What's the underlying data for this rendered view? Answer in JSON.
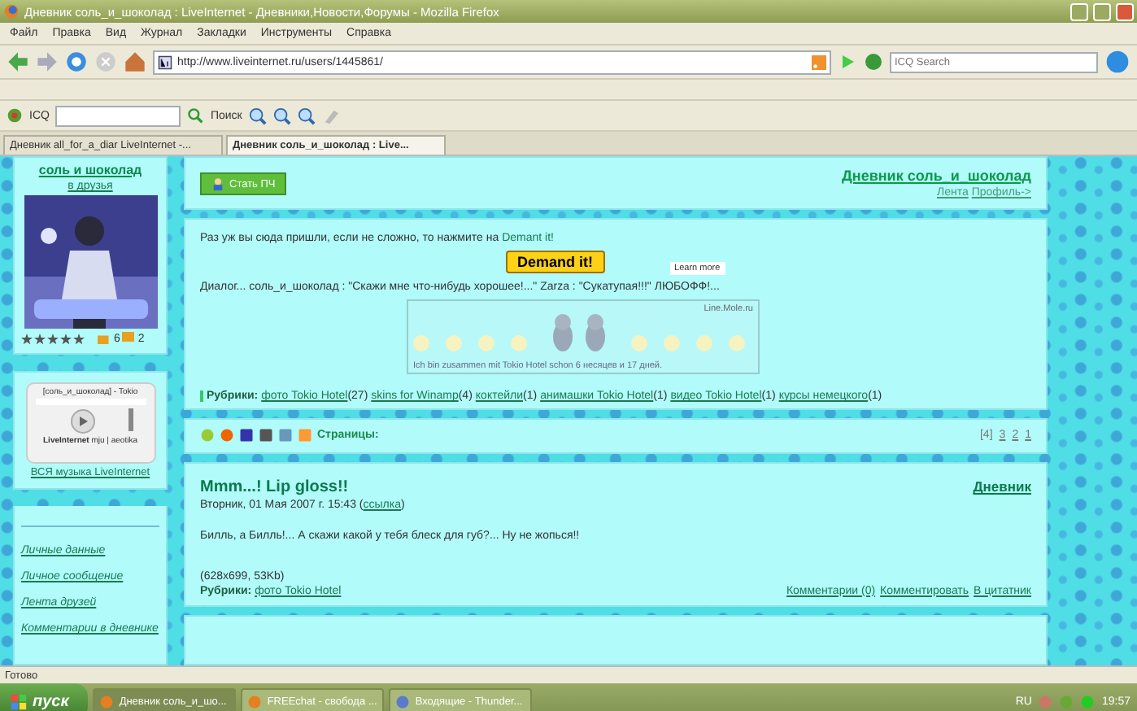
{
  "window": {
    "title": "Дневник соль_и_шоколад : LiveInternet - Дневники,Новости,Форумы - Mozilla Firefox"
  },
  "menu": [
    "Файл",
    "Правка",
    "Вид",
    "Журнал",
    "Закладки",
    "Инструменты",
    "Справка"
  ],
  "navbar": {
    "url": "http://www.liveinternet.ru/users/1445861/",
    "search_placeholder": "ICQ Search"
  },
  "icq_toolbar": {
    "label": "ICQ",
    "search_button": "Поиск"
  },
  "tabs": [
    {
      "label": "Дневник all_for_a_diar LiveInternet -...",
      "selected": false
    },
    {
      "label": "Дневник соль_и_шоколад : Live...",
      "selected": true
    }
  ],
  "sidebar": {
    "username": "соль и шоколад",
    "friends_link": "в друзья",
    "stars": 5,
    "counts": [
      "6",
      "2"
    ],
    "player": {
      "title": "[соль_и_шоколад] - Tokio",
      "brand": "LiveInternet",
      "label": "mju | aeotika",
      "link": "ВСЯ музыка LiveInternet"
    },
    "links": [
      "Личные данные",
      "Личное сообщение",
      "Лента друзей",
      "Комментарии в дневнике"
    ]
  },
  "header": {
    "button": "Стать ПЧ",
    "title": "Дневник соль_и_шоколад",
    "links": [
      "Лента",
      "Профиль->"
    ]
  },
  "intro": {
    "text": "Раз уж вы сюда пришли, если не сложно, то нажмите на ",
    "link": "Demant it!",
    "demand_button": "Demand it!",
    "learn_more": "Learn more",
    "dialog": "Диалог... соль_и_шоколад : \"Скажи мне что-нибудь хорошее!...\" Zarza : \"Сукатупая!!!\" ЛЮБОФФ!...",
    "banner": {
      "site": "Line.Mole.ru",
      "caption": "Ich bin zusammen mit Tokio Hotel schon 6 несяцев и 17 дней."
    },
    "rubrics_label": "Рубрики:",
    "rubrics": [
      {
        "name": "фото Tokio Hotel",
        "count": "(27)"
      },
      {
        "name": "skins for Winamp",
        "count": "(4)"
      },
      {
        "name": "коктейли",
        "count": "(1)"
      },
      {
        "name": "анимашки Tokio Hotel",
        "count": "(1)"
      },
      {
        "name": "видео Tokio Hotel",
        "count": "(1)"
      },
      {
        "name": "курсы немецкого",
        "count": "(1)"
      }
    ]
  },
  "pager": {
    "label": "Страницы:",
    "pages": [
      {
        "label": "[4]",
        "selected": true
      },
      {
        "label": "3",
        "selected": false
      },
      {
        "label": "2",
        "selected": false
      },
      {
        "label": "1",
        "selected": false
      }
    ]
  },
  "post": {
    "title": "Mmm...! Lip gloss!!",
    "diary_link": "Дневник",
    "date": "Вторник, 01 Мая 2007 г. 15:43 (",
    "date_link": "ссылка",
    "date_end": ")",
    "body": "Билль, а Билль!... А скажи какой у тебя блеск для губ?... Ну не жопься!!",
    "image_caption": "(628x699, 53Kb)",
    "rubrics_label": "Рубрики:",
    "rubric": "фото Tokio Hotel",
    "actions": [
      "Комментарии (0)",
      "Комментировать",
      "В цитатник"
    ]
  },
  "status_bar": "Готово",
  "taskbar": {
    "start": "пуск",
    "tasks": [
      {
        "label": "Дневник соль_и_шо...",
        "selected": true
      },
      {
        "label": "FREEchat - свобода ...",
        "selected": false
      },
      {
        "label": "Входящие - Thunder...",
        "selected": false
      }
    ],
    "lang": "RU",
    "clock": "19:57"
  }
}
